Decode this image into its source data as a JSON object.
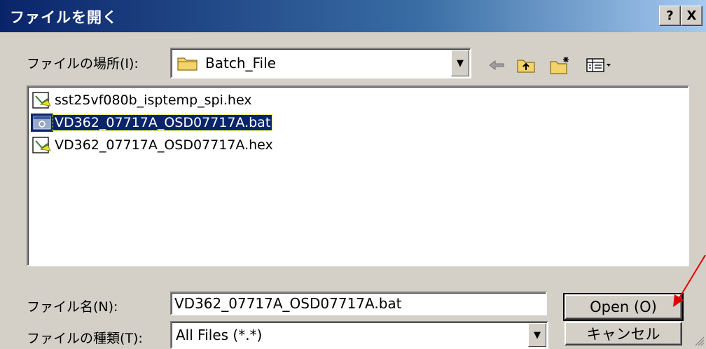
{
  "window": {
    "title": "ファイルを開く",
    "help_label": "?",
    "close_label": "X"
  },
  "look_in": {
    "label": "ファイルの場所(I):",
    "value": "Batch_File"
  },
  "files": [
    {
      "name": "sst25vf080b_isptemp_spi.hex",
      "icon": "hex-file-icon",
      "selected": false
    },
    {
      "name": "VD362_07717A_OSD07717A.bat",
      "icon": "batch-file-icon",
      "selected": true
    },
    {
      "name": "VD362_07717A_OSD07717A.hex",
      "icon": "hex-file-icon",
      "selected": false
    }
  ],
  "filename": {
    "label": "ファイル名(N):",
    "value": "VD362_07717A_OSD07717A.bat"
  },
  "filetype": {
    "label": "ファイルの種類(T):",
    "value": "All Files (*.*)"
  },
  "buttons": {
    "open": "Open (O)",
    "cancel": "キャンセル"
  },
  "colors": {
    "title_start": "#0a246a",
    "title_end": "#a6caf0",
    "face": "#d4d0c8",
    "selection": "#0a246a",
    "annotation_arrow": "#e00000"
  }
}
